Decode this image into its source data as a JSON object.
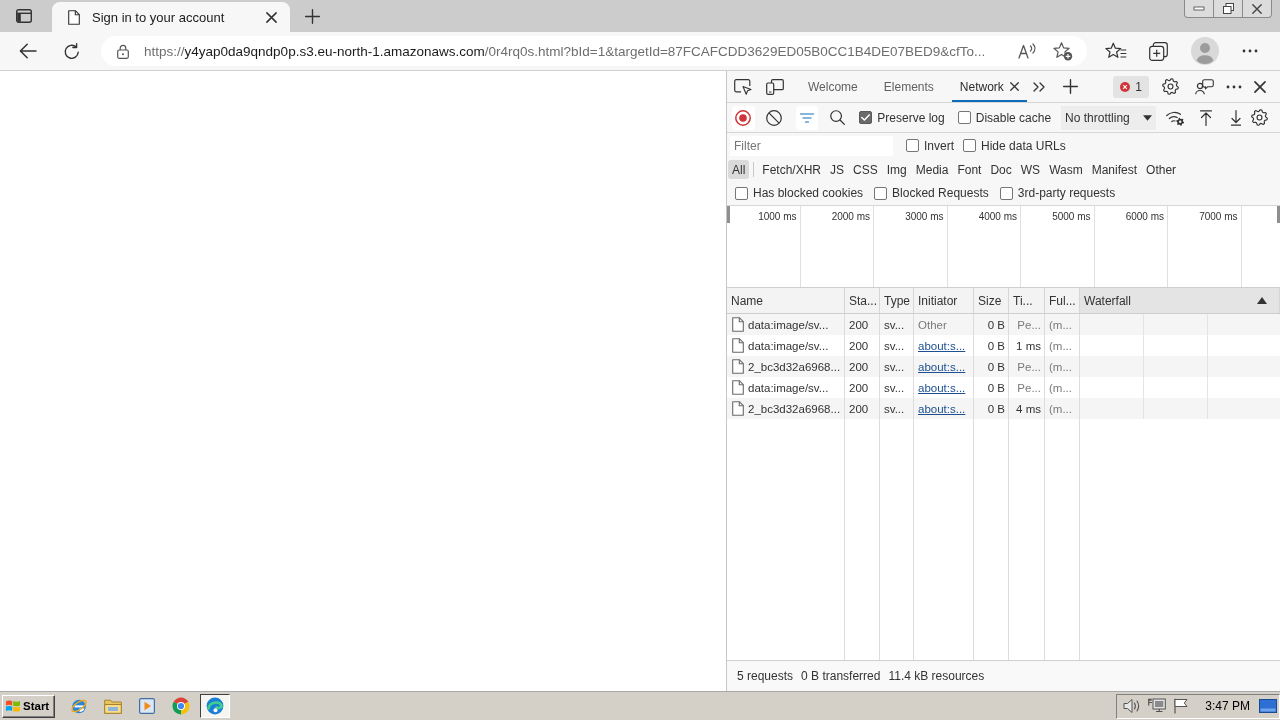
{
  "browser": {
    "tabs": [
      {
        "title": "Sign in to your account",
        "selected": true
      }
    ],
    "address": {
      "scheme": "https://",
      "host": "y4yap0da9qndp0p.s3.eu-north-1.amazonaws.com",
      "rest": "/0r4rq0s.html?bId=1&targetId=87FCAFCDD3629ED05B0CC1B4DE07BED9&cfTo..."
    }
  },
  "devtools": {
    "tabs": [
      {
        "label": "Welcome",
        "selected": false
      },
      {
        "label": "Elements",
        "selected": false
      },
      {
        "label": "Network",
        "selected": true
      }
    ],
    "error_count": "1",
    "recording": true,
    "filter_bar_open": true,
    "options": [
      {
        "label": "Preserve log",
        "checked": true
      },
      {
        "label": "Disable cache",
        "checked": false
      }
    ],
    "throttling": "No throttling",
    "filter": {
      "placeholder": "Filter",
      "options": [
        {
          "label": "Invert",
          "checked": false
        },
        {
          "label": "Hide data URLs",
          "checked": false
        }
      ]
    },
    "types": [
      {
        "label": "All",
        "selected": true
      },
      {
        "label": "Fetch/XHR",
        "selected": false
      },
      {
        "label": "JS",
        "selected": false
      },
      {
        "label": "CSS",
        "selected": false
      },
      {
        "label": "Img",
        "selected": false
      },
      {
        "label": "Media",
        "selected": false
      },
      {
        "label": "Font",
        "selected": false
      },
      {
        "label": "Doc",
        "selected": false
      },
      {
        "label": "WS",
        "selected": false
      },
      {
        "label": "Wasm",
        "selected": false
      },
      {
        "label": "Manifest",
        "selected": false
      },
      {
        "label": "Other",
        "selected": false
      }
    ],
    "request_filters": [
      {
        "label": "Has blocked cookies",
        "checked": false
      },
      {
        "label": "Blocked Requests",
        "checked": false
      },
      {
        "label": "3rd-party requests",
        "checked": false
      }
    ],
    "overview": {
      "ticks": [
        "1000 ms",
        "2000 ms",
        "3000 ms",
        "4000 ms",
        "5000 ms",
        "6000 ms",
        "7000 ms"
      ]
    },
    "table": {
      "columns": [
        {
          "label": "Name",
          "sorted": false
        },
        {
          "label": "Sta...",
          "sorted": false
        },
        {
          "label": "Type",
          "sorted": false
        },
        {
          "label": "Initiator",
          "sorted": false
        },
        {
          "label": "Size",
          "sorted": false
        },
        {
          "label": "Ti...",
          "sorted": false
        },
        {
          "label": "Ful...",
          "sorted": false
        },
        {
          "label": "Waterfall",
          "sorted": true
        }
      ],
      "rows": [
        {
          "cells": [
            "data:image/sv...",
            "200",
            "sv...",
            "Other",
            "0 B",
            "Pe...",
            "(m..."
          ],
          "initiator_link": false,
          "pending": true
        },
        {
          "cells": [
            "data:image/sv...",
            "200",
            "sv...",
            "about:s...",
            "0 B",
            "1 ms",
            "(m..."
          ],
          "initiator_link": true,
          "pending": false
        },
        {
          "cells": [
            "2_bc3d32a6968...",
            "200",
            "sv...",
            "about:s...",
            "0 B",
            "Pe...",
            "(m..."
          ],
          "initiator_link": true,
          "pending": true
        },
        {
          "cells": [
            "data:image/sv...",
            "200",
            "sv...",
            "about:s...",
            "0 B",
            "Pe...",
            "(m..."
          ],
          "initiator_link": true,
          "pending": true
        },
        {
          "cells": [
            "2_bc3d32a6968...",
            "200",
            "sv...",
            "about:s...",
            "0 B",
            "4 ms",
            "(m..."
          ],
          "initiator_link": true,
          "pending": false
        }
      ]
    },
    "status_bar": [
      "5 requests",
      "0 B transferred",
      "11.4 kB resources"
    ]
  },
  "taskbar": {
    "start": "Start",
    "apps": [
      {
        "kind": "ie",
        "selected": false
      },
      {
        "kind": "folder",
        "selected": false
      },
      {
        "kind": "media",
        "selected": false
      },
      {
        "kind": "chrome",
        "selected": false
      },
      {
        "kind": "edge",
        "selected": true
      }
    ],
    "clock": "3:47 PM"
  }
}
